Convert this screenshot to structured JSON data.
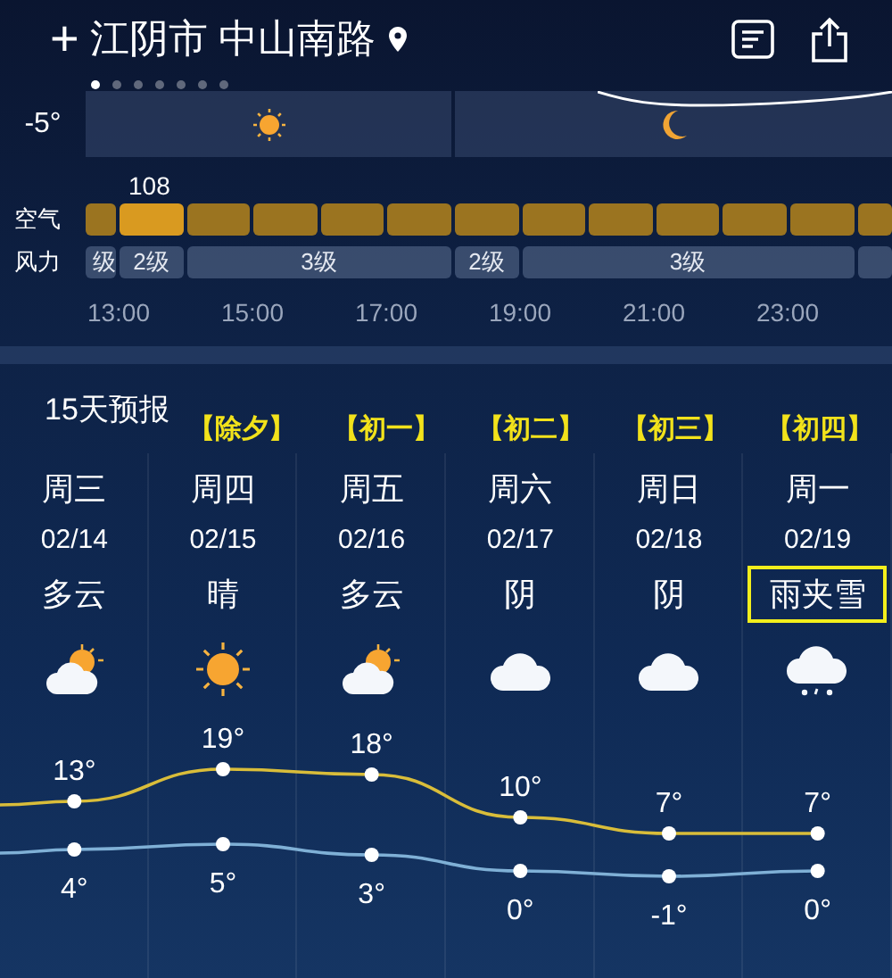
{
  "header": {
    "add": "+",
    "location": "江阴市 中山南路"
  },
  "page_dots": [
    {
      "selected": true
    },
    {
      "selected": false
    },
    {
      "selected": false
    },
    {
      "selected": false
    },
    {
      "selected": false
    },
    {
      "selected": false
    },
    {
      "selected": false
    }
  ],
  "hourly": {
    "temperature": "-5°",
    "air": {
      "label": "空气",
      "reading": "108",
      "bars": [
        {
          "selected": false
        },
        {
          "selected": true
        },
        {
          "selected": false
        },
        {
          "selected": false
        },
        {
          "selected": false
        },
        {
          "selected": false
        },
        {
          "selected": false
        },
        {
          "selected": false
        },
        {
          "selected": false
        },
        {
          "selected": false
        },
        {
          "selected": false
        },
        {
          "selected": false
        },
        {
          "selected": false
        }
      ]
    },
    "wind": {
      "label": "风力",
      "segments": [
        {
          "kind": "level",
          "text": "级"
        },
        {
          "kind": "level",
          "text": "2级"
        },
        {
          "kind": "level",
          "text": "3级"
        },
        {
          "kind": "level",
          "text": "2级"
        },
        {
          "kind": "level",
          "text": "3级"
        },
        {
          "kind": "blank"
        }
      ]
    },
    "times": [
      "13:00",
      "15:00",
      "17:00",
      "19:00",
      "21:00",
      "23:00"
    ]
  },
  "forecast": {
    "title": "15天预报",
    "days": [
      {
        "weekday": "周三",
        "date": "02/14",
        "condition": "多云",
        "kind": "partly-cloudy",
        "highlighted": false
      },
      {
        "lunar": "【除夕】",
        "weekday": "周四",
        "date": "02/15",
        "condition": "晴",
        "kind": "sunny",
        "highlighted": false
      },
      {
        "lunar": "【初一】",
        "weekday": "周五",
        "date": "02/16",
        "condition": "多云",
        "kind": "partly-cloudy",
        "highlighted": false
      },
      {
        "lunar": "【初二】",
        "weekday": "周六",
        "date": "02/17",
        "condition": "阴",
        "kind": "cloudy",
        "highlighted": false
      },
      {
        "lunar": "【初三】",
        "weekday": "周日",
        "date": "02/18",
        "condition": "阴",
        "kind": "cloudy",
        "highlighted": false
      },
      {
        "lunar": "【初四】",
        "weekday": "周一",
        "date": "02/19",
        "condition": "雨夹雪",
        "kind": "sleet",
        "highlighted": true
      }
    ],
    "chart_data": {
      "type": "line",
      "categories": [
        null,
        null,
        null,
        null,
        null,
        null
      ],
      "series": [
        {
          "color": "#d9bd3a",
          "marker": "circle",
          "values": [
            13,
            19,
            18,
            10,
            7,
            7
          ],
          "value_labels": [
            "13°",
            "19°",
            "18°",
            "10°",
            "7°",
            "7°"
          ]
        },
        {
          "color": "#7fb0d6",
          "marker": "circle",
          "values": [
            4,
            5,
            3,
            0,
            -1,
            0
          ],
          "value_labels": [
            "4°",
            "5°",
            "3°",
            "0°",
            "-1°",
            "0°"
          ]
        }
      ],
      "data_labels": true
    }
  }
}
